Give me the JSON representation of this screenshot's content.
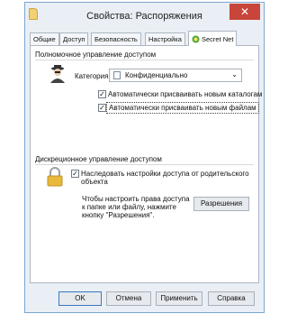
{
  "window": {
    "title": "Свойства: Распоряжения",
    "close_glyph": "✕",
    "icon": "folder-icon"
  },
  "tabs": [
    {
      "label": "Общие"
    },
    {
      "label": "Доступ"
    },
    {
      "label": "Безопасность"
    },
    {
      "label": "Настройка"
    },
    {
      "label": "Secret Net",
      "active": true,
      "icon": "secret-net-icon"
    }
  ],
  "mandatory": {
    "heading": "Полномочное управление доступом",
    "category_label": "Категория:",
    "category_value": "Конфиденциально",
    "checkboxes": [
      {
        "label": "Автоматически присваивать новым каталогам",
        "checked": true
      },
      {
        "label": "Автоматически присваивать новым файлам",
        "checked": true
      }
    ]
  },
  "discretionary": {
    "heading": "Дискреционное управление доступом",
    "inherit_line1": "Наследовать настройки доступа от родительского",
    "inherit_line2": "объекта",
    "inherit_checked": true,
    "hint_line1": "Чтобы настроить права доступа",
    "hint_line2": "к папке или файлу, нажмите",
    "hint_line3": "кнопку \"Разрешения\".",
    "permissions_button": "Разрешения"
  },
  "footer": {
    "ok": "OK",
    "cancel": "Отмена",
    "apply": "Применить",
    "help": "Справка"
  },
  "colors": {
    "close": "#c7453a",
    "accent": "#3a78c2",
    "lock": "#e8b93a"
  }
}
